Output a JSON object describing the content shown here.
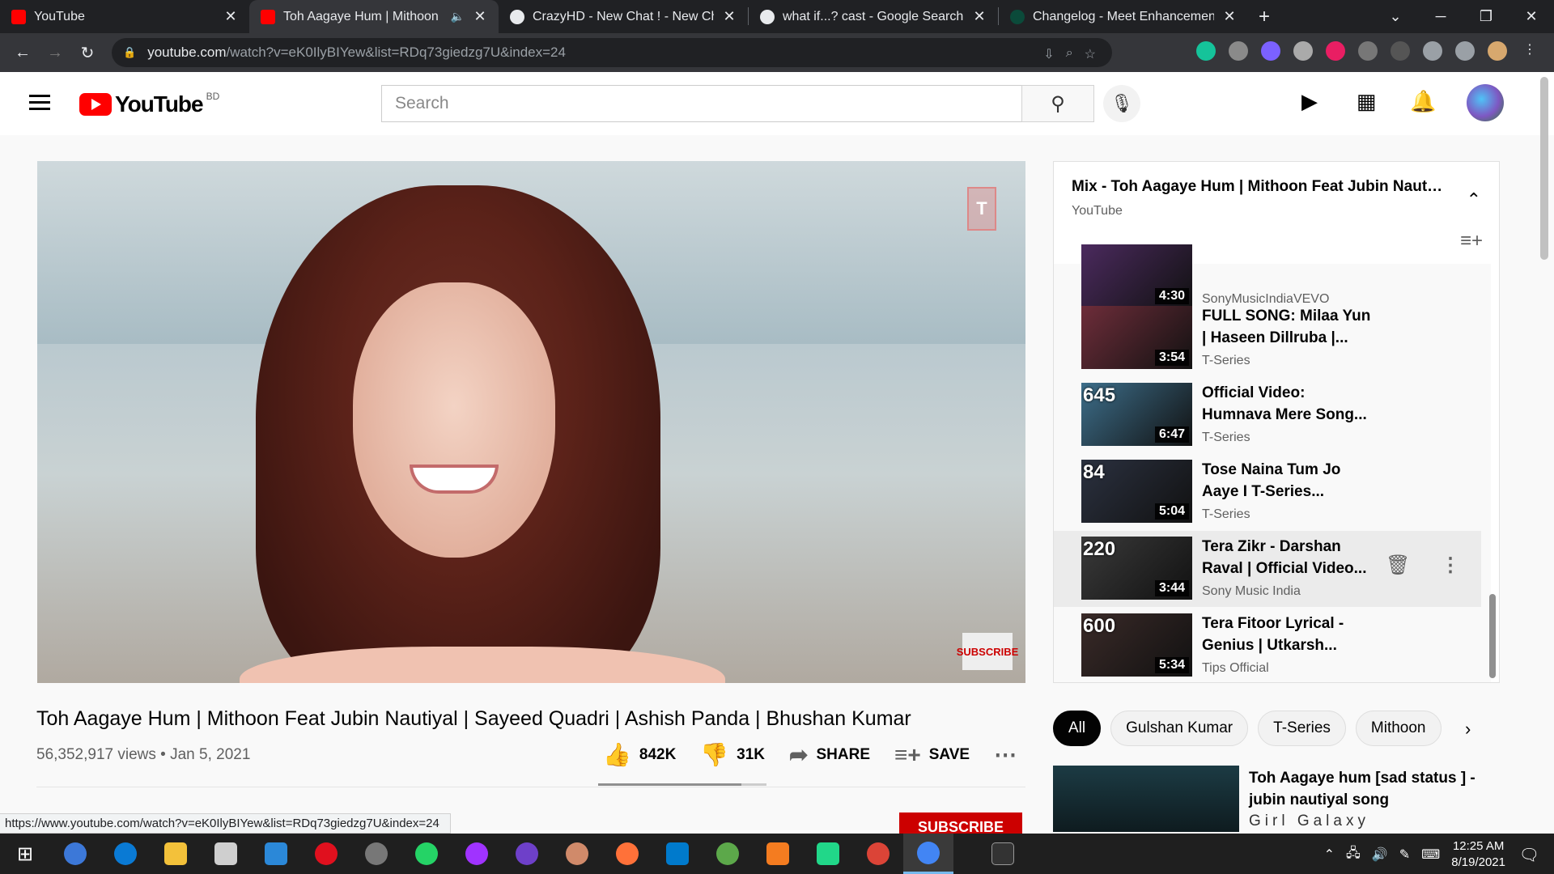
{
  "browser": {
    "tabs": [
      {
        "title": "YouTube",
        "fav_color": "#ff0000"
      },
      {
        "title": "Toh Aagaye Hum | Mithoon Fe",
        "fav_color": "#ff0000"
      },
      {
        "title": "CrazyHD - New Chat ! - New Cha",
        "fav_color": "#e8eaed"
      },
      {
        "title": "what if...? cast - Google Search",
        "fav_color": "#e8eaed"
      },
      {
        "title": "Changelog - Meet Enhancement",
        "fav_color": "#0b4a3a"
      }
    ],
    "url_host": "youtube.com",
    "url_path": "/watch?v=eK0IlyBIYew&list=RDq73giedzg7U&index=24",
    "status_url": "https://www.youtube.com/watch?v=eK0IlyBIYew&list=RDq73giedzg7U&index=24"
  },
  "youtube": {
    "logo_text": "YouTube",
    "region": "BD",
    "search_placeholder": "Search"
  },
  "video": {
    "title": "Toh Aagaye Hum | Mithoon Feat Jubin Nautiyal | Sayeed Quadri | Ashish Panda | Bhushan Kumar",
    "views_date": "56,352,917 views • Jan 5, 2021",
    "likes": "842K",
    "dislikes": "31K",
    "share_label": "SHARE",
    "save_label": "SAVE",
    "subscribe_label": "SUBSCRIBE",
    "watermark_subscribe": "SUBSCRIBE",
    "like_ratio": 0.85
  },
  "playlist": {
    "title": "Mix - Toh Aagaye Hum | Mithoon Feat Jubin Nautiyal",
    "channel": "YouTube",
    "items": [
      {
        "title": "",
        "channel": "SonyMusicIndiaVEVO",
        "duration": "4:30",
        "badge": "",
        "bg": "#4b2a5e"
      },
      {
        "title": "FULL SONG: Milaa Yun | Haseen Dillruba |...",
        "channel": "T-Series",
        "duration": "3:54",
        "badge": "",
        "bg": "#6e2d3a"
      },
      {
        "title": "Official Video: Humnava Mere Song...",
        "channel": "T-Series",
        "duration": "6:47",
        "badge": "645",
        "bg": "#3d6e8a"
      },
      {
        "title": "Tose Naina Tum Jo Aaye I T-Series...",
        "channel": "T-Series",
        "duration": "5:04",
        "badge": "84",
        "bg": "#2b3140"
      },
      {
        "title": "Tera Zikr - Darshan Raval | Official Video...",
        "channel": "Sony Music India",
        "duration": "3:44",
        "badge": "220",
        "bg": "#3a3a3a"
      },
      {
        "title": "Tera Fitoor Lyrical - Genius | Utkarsh...",
        "channel": "Tips Official",
        "duration": "5:34",
        "badge": "600",
        "bg": "#3a2a28"
      }
    ]
  },
  "chips": [
    "All",
    "Gulshan Kumar",
    "T-Series",
    "Mithoon"
  ],
  "recommendation": {
    "title": "Toh Aagaye hum [sad status ] - jubin nautiyal song",
    "channel": "Girl Galaxy"
  },
  "taskbar": {
    "time": "12:25 AM",
    "date": "8/19/2021"
  }
}
